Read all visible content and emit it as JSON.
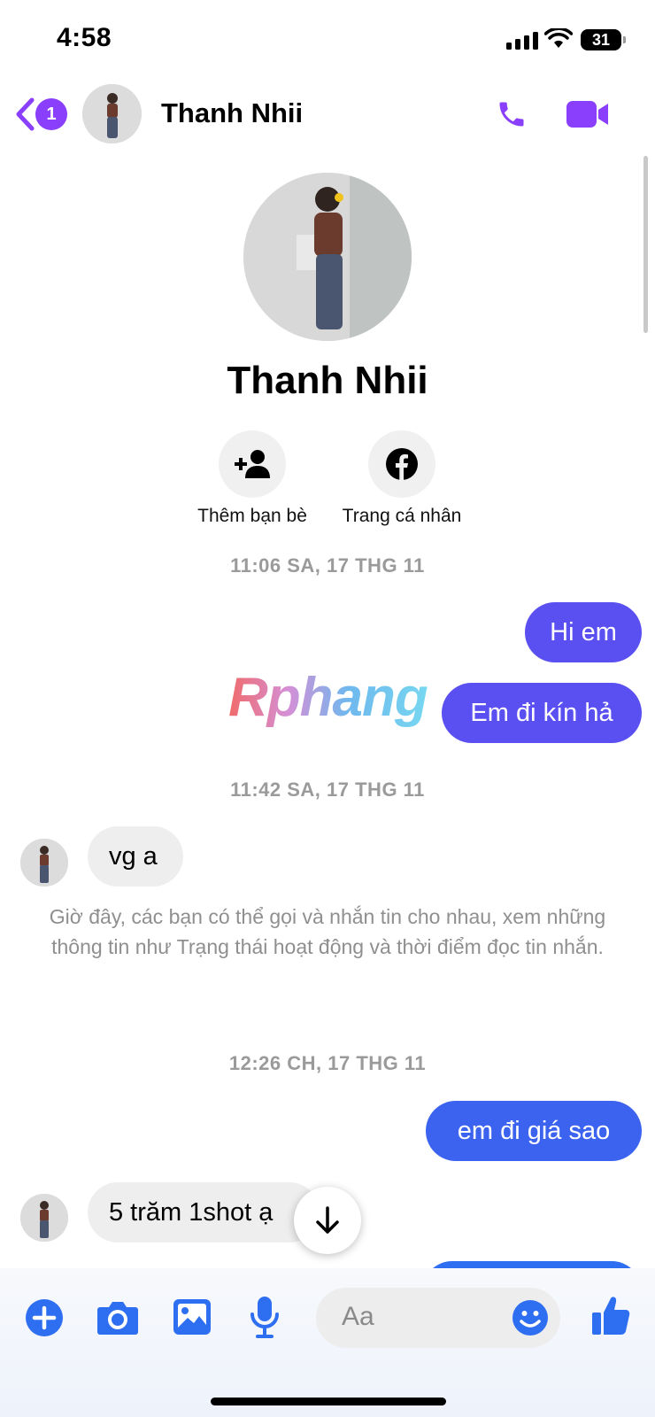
{
  "status_bar": {
    "time": "4:58",
    "battery": "31"
  },
  "header": {
    "back_badge": "1",
    "contact_name": "Thanh Nhii"
  },
  "profile": {
    "name": "Thanh Nhii",
    "actions": [
      {
        "label": "Thêm bạn bè",
        "icon": "add-friend-icon"
      },
      {
        "label": "Trang cá nhân",
        "icon": "facebook-icon"
      }
    ]
  },
  "watermark": "Rphang",
  "conversation": {
    "timestamps": [
      "11:06 SA, 17 THG 11",
      "11:42 SA, 17 THG 11",
      "12:26 CH, 17 THG 11"
    ],
    "outgoing": [
      "Hi em",
      "Em đi kín hả",
      "em đi giá sao"
    ],
    "incoming": [
      "vg a",
      "5 trăm 1shot ạ"
    ],
    "system_notice": "Giờ đây, các bạn có thể gọi và nhắn tin cho nhau, xem những thông tin như Trạng thái hoạt động và thời điểm đọc tin nhắn."
  },
  "composer": {
    "placeholder": "Aa"
  },
  "colors": {
    "accent_purple": "#8a3ffc",
    "bubble_purple": "#5a4ff0",
    "bubble_blue": "#3b63f0",
    "composer_blue": "#2e6ef0"
  }
}
